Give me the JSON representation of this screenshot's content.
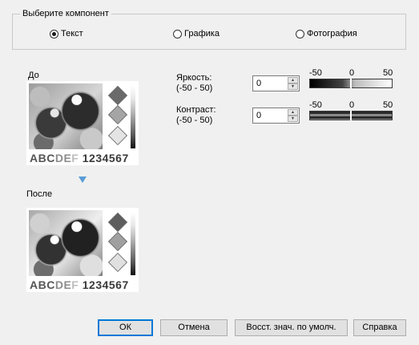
{
  "group": {
    "title": "Выберите компонент",
    "options": [
      {
        "label": "Текст",
        "checked": true
      },
      {
        "label": "Графика",
        "checked": false
      },
      {
        "label": "Фотография",
        "checked": false
      }
    ]
  },
  "before": {
    "label": "До",
    "sample_letters": [
      "ABC",
      "DE",
      "F"
    ],
    "sample_numbers": "1234567"
  },
  "after": {
    "label": "После",
    "sample_letters": [
      "ABC",
      "DE",
      "F"
    ],
    "sample_numbers": "1234567"
  },
  "brightness": {
    "label_line1": "Яркость:",
    "label_line2": "(-50 - 50)",
    "value": "0",
    "scale_min": "-50",
    "scale_mid": "0",
    "scale_max": "50"
  },
  "contrast": {
    "label_line1": "Контраст:",
    "label_line2": "(-50 - 50)",
    "value": "0",
    "scale_min": "-50",
    "scale_mid": "0",
    "scale_max": "50"
  },
  "buttons": {
    "ok": "ОК",
    "cancel": "Отмена",
    "restore": "Восст. знач. по умолч.",
    "help": "Справка"
  },
  "colors": {
    "accent": "#0078d7",
    "arrow": "#5b9bd5",
    "background": "#f0f0f0"
  },
  "icons": {
    "arrow_down": "triangle-down-icon",
    "spin_up": "spin-up-icon",
    "spin_down": "spin-down-icon"
  }
}
